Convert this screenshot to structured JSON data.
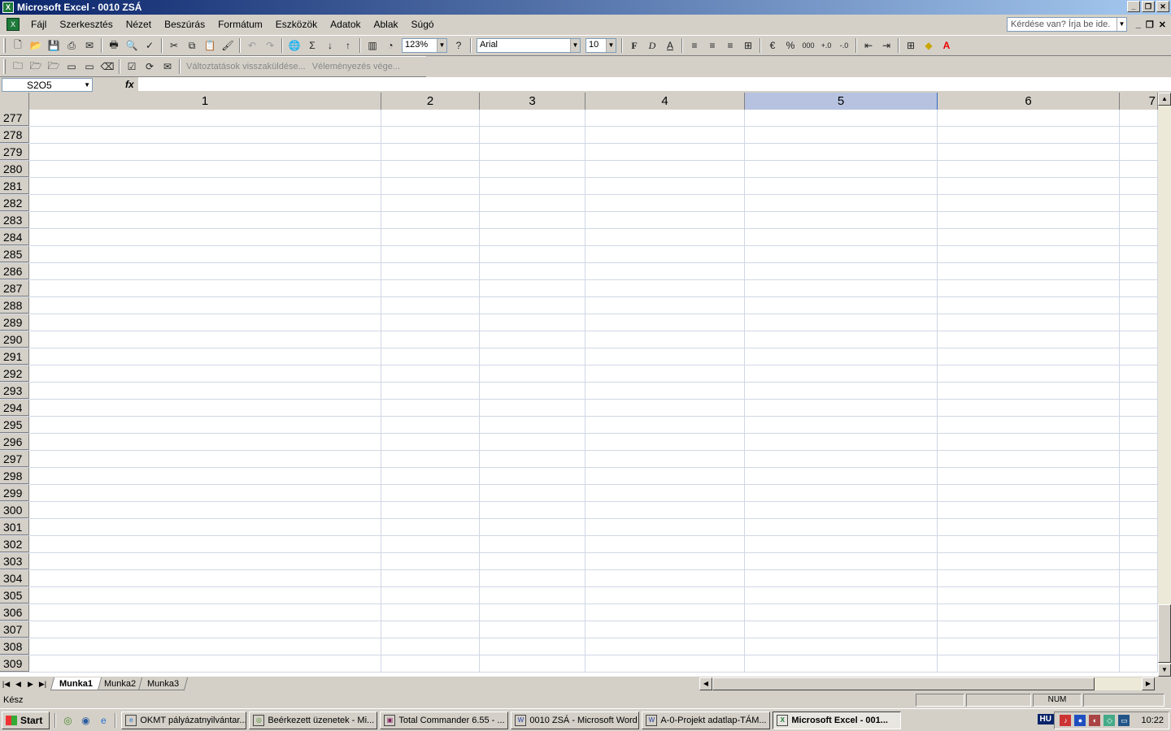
{
  "window": {
    "title": "Microsoft Excel - 0010 ZSÁ",
    "app_icon": "excel-icon",
    "buttons": [
      "_",
      "❐",
      "✕"
    ]
  },
  "menu": {
    "items": [
      "Fájl",
      "Szerkesztés",
      "Nézet",
      "Beszúrás",
      "Formátum",
      "Eszközök",
      "Adatok",
      "Ablak",
      "Súgó"
    ],
    "help_placeholder": "Kérdése van? Írja be ide.",
    "doc_buttons": [
      "_",
      "❐",
      "✕"
    ]
  },
  "toolbar": {
    "zoom": "123%",
    "font_name": "Arial",
    "font_size": "10",
    "bold": "F",
    "italic": "D",
    "underline": "A"
  },
  "reviewing": {
    "send_back": "Változtatások visszaküldése...",
    "end_review": "Véleményezés vége..."
  },
  "formula_bar": {
    "name_box": "S2O5",
    "fx": "fx",
    "formula": ""
  },
  "sheet": {
    "columns": [
      {
        "label": "1",
        "selected": false
      },
      {
        "label": "2",
        "selected": false
      },
      {
        "label": "3",
        "selected": false
      },
      {
        "label": "4",
        "selected": false
      },
      {
        "label": "5",
        "selected": true
      },
      {
        "label": "6",
        "selected": false
      },
      {
        "label": "7",
        "selected": false
      }
    ],
    "rows": [
      "277",
      "278",
      "279",
      "280",
      "281",
      "282",
      "283",
      "284",
      "285",
      "286",
      "287",
      "288",
      "289",
      "290",
      "291",
      "292",
      "293",
      "294",
      "295",
      "296",
      "297",
      "298",
      "299",
      "300",
      "301",
      "302",
      "303",
      "304",
      "305",
      "306",
      "307",
      "308",
      "309"
    ]
  },
  "tabs": [
    {
      "label": "Munka1",
      "active": true
    },
    {
      "label": "Munka2",
      "active": false
    },
    {
      "label": "Munka3",
      "active": false
    }
  ],
  "status": {
    "text": "Kész",
    "num": "NUM"
  },
  "taskbar": {
    "start": "Start",
    "tasks": [
      {
        "label": "OKMT pályázatnyilvántar...",
        "icon": "ie-icon",
        "active": false
      },
      {
        "label": "Beérkezett üzenetek - Mi...",
        "icon": "mail-icon",
        "active": false
      },
      {
        "label": "Total Commander 6.55 - ...",
        "icon": "floppy-icon",
        "active": false
      },
      {
        "label": "0010 ZSÁ - Microsoft Word",
        "icon": "word-icon",
        "active": false
      },
      {
        "label": "A-0-Projekt adatlap-TÁM...",
        "icon": "word-icon",
        "active": false
      },
      {
        "label": "Microsoft Excel - 001...",
        "icon": "excel-icon",
        "active": true
      }
    ],
    "lang": "HU",
    "clock": "10:22"
  }
}
